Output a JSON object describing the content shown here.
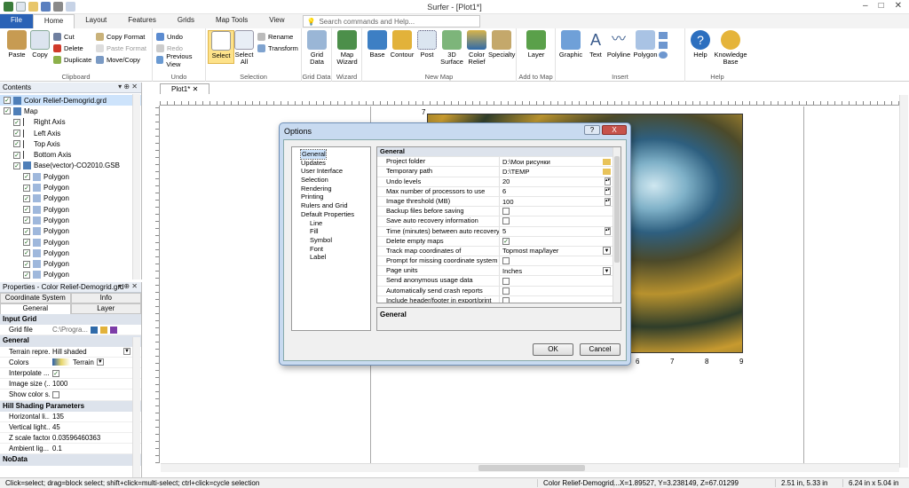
{
  "window": {
    "title": "Surfer - [Plot1*]"
  },
  "ribbon_tabs": [
    "File",
    "Home",
    "Layout",
    "Features",
    "Grids",
    "Map Tools",
    "View"
  ],
  "search_placeholder": "Search commands and Help...",
  "ribbon": {
    "clipboard": {
      "paste": "Paste",
      "copy": "Copy",
      "cut": "Cut",
      "delete": "Delete",
      "duplicate": "Duplicate",
      "copy_format": "Copy Format",
      "paste_format": "Paste Format",
      "move_copy": "Move/Copy",
      "label": "Clipboard"
    },
    "undo": {
      "undo": "Undo",
      "redo": "Redo",
      "previous_view": "Previous View",
      "label": "Undo"
    },
    "selection": {
      "select": "Select",
      "select_all": "Select All",
      "rename": "Rename",
      "transform": "Transform",
      "label": "Selection"
    },
    "grid_data": {
      "button": "Grid Data",
      "label": "Grid Data"
    },
    "wizard": {
      "button": "Map Wizard",
      "label": "Wizard"
    },
    "new_map": {
      "base": "Base",
      "contour": "Contour",
      "post": "Post",
      "surface_3d": "3D Surface",
      "color_relief": "Color Relief",
      "specialty": "Specialty",
      "label": "New Map"
    },
    "add_to_map": {
      "layer": "Layer",
      "label": "Add to Map"
    },
    "insert": {
      "graphic": "Graphic",
      "text": "Text",
      "polyline": "Polyline",
      "polygon": "Polygon",
      "label": "Insert"
    },
    "help": {
      "help": "Help",
      "knowledge_base": "Knowledge Base",
      "label": "Help"
    }
  },
  "contents": {
    "title": "Contents",
    "items": [
      {
        "label": "Color Relief-Demogrid.grd",
        "level": 0,
        "selected": true
      },
      {
        "label": "Map",
        "level": 0
      },
      {
        "label": "Right Axis",
        "level": 1
      },
      {
        "label": "Left Axis",
        "level": 1
      },
      {
        "label": "Top Axis",
        "level": 1
      },
      {
        "label": "Bottom Axis",
        "level": 1
      },
      {
        "label": "Base(vector)-CO2010.GSB",
        "level": 1
      },
      {
        "label": "Polygon",
        "level": 2
      },
      {
        "label": "Polygon",
        "level": 2
      },
      {
        "label": "Polygon",
        "level": 2
      },
      {
        "label": "Polygon",
        "level": 2
      },
      {
        "label": "Polygon",
        "level": 2
      },
      {
        "label": "Polygon",
        "level": 2
      },
      {
        "label": "Polygon",
        "level": 2
      },
      {
        "label": "Polygon",
        "level": 2
      },
      {
        "label": "Polygon",
        "level": 2
      },
      {
        "label": "Polygon",
        "level": 2
      }
    ]
  },
  "properties": {
    "title": "Properties - Color Relief-Demogrid.grd",
    "tabs_top": [
      "Coordinate System",
      "Info"
    ],
    "tabs_bottom": [
      "General",
      "Layer"
    ],
    "sections": {
      "input_grid": "Input Grid",
      "general": "General",
      "hill_shading": "Hill Shading Parameters",
      "nodata": "NoData"
    },
    "rows": {
      "grid_file": {
        "k": "Grid file",
        "v": "C:\\Progra..."
      },
      "terrain_rep": {
        "k": "Terrain repre...",
        "v": "Hill shaded"
      },
      "colors": {
        "k": "Colors",
        "v": "Terrain"
      },
      "interpolate": {
        "k": "Interpolate ...",
        "v": "✓"
      },
      "image_size": {
        "k": "Image size (...",
        "v": "1000"
      },
      "show_color": {
        "k": "Show color s...",
        "v": ""
      },
      "horiz": {
        "k": "Horizontal li...",
        "v": "135"
      },
      "vert": {
        "k": "Vertical light...",
        "v": "45"
      },
      "zscale": {
        "k": "Z scale factor",
        "v": "0.03596460363"
      },
      "ambient": {
        "k": "Ambient lig...",
        "v": "0.1"
      }
    }
  },
  "doc_tab": "Plot1*",
  "axis_labels": {
    "top": "7",
    "bottom": [
      "6",
      "7",
      "8",
      "9"
    ]
  },
  "dialog": {
    "title": "Options",
    "help_btn": "?",
    "close_btn": "X",
    "nav": [
      {
        "label": "General",
        "level": 0,
        "selected": true
      },
      {
        "label": "Updates",
        "level": 0
      },
      {
        "label": "User Interface",
        "level": 0
      },
      {
        "label": "Selection",
        "level": 0
      },
      {
        "label": "Rendering",
        "level": 0
      },
      {
        "label": "Printing",
        "level": 0
      },
      {
        "label": "Rulers and Grid",
        "level": 0
      },
      {
        "label": "Default Properties",
        "level": 0
      },
      {
        "label": "Line",
        "level": 1
      },
      {
        "label": "Fill",
        "level": 1
      },
      {
        "label": "Symbol",
        "level": 1
      },
      {
        "label": "Font",
        "level": 1
      },
      {
        "label": "Label",
        "level": 1
      }
    ],
    "section": "General",
    "rows": [
      {
        "k": "Project folder",
        "v": "D:\\Мои рисунки",
        "ctl": "folder"
      },
      {
        "k": "Temporary path",
        "v": "D:\\TEMP",
        "ctl": "folder"
      },
      {
        "k": "Undo levels",
        "v": "20",
        "ctl": "spin"
      },
      {
        "k": "Max number of processors to use",
        "v": "6",
        "ctl": "spin"
      },
      {
        "k": "Image threshold (MB)",
        "v": "100",
        "ctl": "spin"
      },
      {
        "k": "Backup files before saving",
        "v": "",
        "ctl": "check"
      },
      {
        "k": "Save auto recovery information",
        "v": "",
        "ctl": "check"
      },
      {
        "k": "Time (minutes) between auto recovery sa...",
        "v": "5",
        "ctl": "spin"
      },
      {
        "k": "Delete empty maps",
        "v": "✓",
        "ctl": "check"
      },
      {
        "k": "Track map coordinates of",
        "v": "Topmost map/layer",
        "ctl": "drop"
      },
      {
        "k": "Prompt for missing coordinate system",
        "v": "",
        "ctl": "check"
      },
      {
        "k": "Page units",
        "v": "Inches",
        "ctl": "drop"
      },
      {
        "k": "Send anonymous usage data",
        "v": "",
        "ctl": "check"
      },
      {
        "k": "Automatically send crash reports",
        "v": "",
        "ctl": "check"
      },
      {
        "k": "Include header/footer in export/print",
        "v": "",
        "ctl": "check"
      }
    ],
    "description_title": "General",
    "ok": "OK",
    "cancel": "Cancel"
  },
  "status": {
    "hint": "Click=select; drag=block select; shift+click=multi-select; ctrl+click=cycle selection",
    "object": "Color Relief-Demogrid....",
    "coords": "X=1.89527, Y=3.238149, Z=67.01299",
    "cursor": "2.51 in, 5.33 in",
    "size": "6.24 in x 5.04 in"
  },
  "colors": {
    "accent": "#2a62b6",
    "selected": "#fde28a",
    "dialog_frame": "#c8daf0",
    "close_red": "#c7524b"
  }
}
